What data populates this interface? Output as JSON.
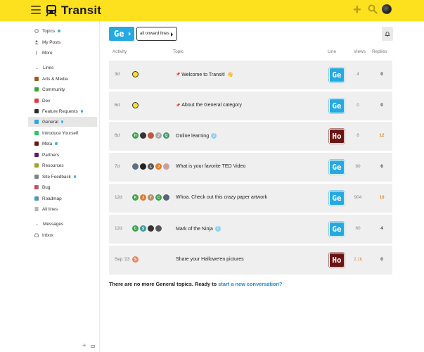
{
  "header": {
    "brand": "Transit",
    "menu_icon": "hamburger-icon",
    "logo_icon": "tram-icon",
    "actions": [
      "plus-icon",
      "search-icon",
      "avatar"
    ]
  },
  "sidebar": {
    "top": [
      {
        "label": "Topics",
        "icon": "topics-icon",
        "dot": true
      },
      {
        "label": "My Posts",
        "icon": "user-icon",
        "dot": false
      },
      {
        "label": "More",
        "icon": "more-icon",
        "dot": false
      }
    ],
    "lines_header": "Lines",
    "lines": [
      {
        "label": "Arts & Media",
        "color": "#a15a17",
        "dot": false
      },
      {
        "label": "Community",
        "color": "#3aa533",
        "dot": false
      },
      {
        "label": "Dev",
        "color": "#e5383b",
        "dot": false
      },
      {
        "label": "Feature Requests",
        "color": "#2b2b2b",
        "dot": true
      },
      {
        "label": "General",
        "color": "#25a9e0",
        "dot": true,
        "active": true
      },
      {
        "label": "Introduce Yourself",
        "color": "#2ac95b",
        "dot": false
      },
      {
        "label": "Meta",
        "color": "#6b1413",
        "dot": true
      },
      {
        "label": "Partners",
        "color": "#5b1d7a",
        "dot": false
      },
      {
        "label": "Resources",
        "color": "#a2a12c",
        "dot": false
      },
      {
        "label": "Site Feedback",
        "color": "#808285",
        "dot": true
      },
      {
        "label": "Bug",
        "color": "split-red",
        "dot": false
      },
      {
        "label": "Roadmap",
        "color": "split-blue",
        "dot": false
      },
      {
        "label": "All lines",
        "color": "list-icon",
        "dot": false
      }
    ],
    "messages_header": "Messages",
    "messages": [
      {
        "label": "Inbox",
        "icon": "inbox-icon"
      }
    ]
  },
  "toolbar": {
    "crumb_line": "Ge",
    "crumb_onward": "all onward lines"
  },
  "columns": {
    "activity": "Activity",
    "topic": "Topic",
    "line": "Line",
    "views": "Views",
    "replies": "Replies"
  },
  "topics": [
    {
      "activity": "3d",
      "title": "Welcome to Transit!",
      "pinned": true,
      "emoji": "👋",
      "line": "Ge",
      "line_kind": "ge",
      "views": "4",
      "replies": "0",
      "posters": [
        "#fde11e"
      ],
      "poster_letters": [
        ""
      ],
      "badge": ""
    },
    {
      "activity": "6d",
      "title": "About the General category",
      "pinned": true,
      "emoji": "",
      "line": "Ge",
      "line_kind": "ge",
      "views": "0",
      "replies": "0",
      "posters": [
        "#fde11e"
      ],
      "poster_letters": [
        ""
      ],
      "badge": ""
    },
    {
      "activity": "6d",
      "title": "Online learning",
      "pinned": false,
      "emoji": "",
      "line": "Ho",
      "line_kind": "ho",
      "views": "8",
      "replies": "12",
      "replies_hot": true,
      "posters": [
        "#3aa54a",
        "#333333",
        "#c1573d",
        "#a9a9a9",
        "#3f9a6b"
      ],
      "poster_letters": [
        "H",
        "",
        "",
        "J",
        "Q"
      ],
      "badge": "2"
    },
    {
      "activity": "7d",
      "title": "What is your favorite TED Video",
      "pinned": false,
      "emoji": "",
      "line": "Ge",
      "line_kind": "ge",
      "views": "80",
      "replies": "6",
      "posters": [
        "#5c7080",
        "#222222",
        "#555555",
        "#e07a2c",
        "#c8a0a0"
      ],
      "poster_letters": [
        "",
        "",
        "L",
        "J",
        ""
      ],
      "badge": ""
    },
    {
      "activity": "12d",
      "title": "Whoa. Check out this crazy paper artwork",
      "pinned": false,
      "emoji": "",
      "line": "Ge",
      "line_kind": "ge",
      "views": "904",
      "replies": "10",
      "replies_hot": true,
      "posters": [
        "#3aa54a",
        "#e07a2c",
        "#b68d6e",
        "#3aa54a",
        "#556677"
      ],
      "poster_letters": [
        "K",
        "J",
        "T",
        "C",
        ""
      ],
      "badge": ""
    },
    {
      "activity": "12d",
      "title": "Mark of the Ninja",
      "pinned": false,
      "emoji": "",
      "line": "Ge",
      "line_kind": "ge",
      "views": "60",
      "replies": "4",
      "posters": [
        "#3aa54a",
        "#3f9a9a",
        "#333333",
        "#555555"
      ],
      "poster_letters": [
        "C",
        "S",
        "",
        ""
      ],
      "badge": "1"
    },
    {
      "activity": "Sep '23",
      "title": "Share your Hallowe'en pictures",
      "pinned": false,
      "emoji": "",
      "line": "Ho",
      "line_kind": "ho",
      "views": "2.1k",
      "views_hot": true,
      "replies": "0",
      "posters": [
        "#e48a5c"
      ],
      "poster_letters": [
        "S"
      ],
      "badge": ""
    }
  ],
  "footer": {
    "text": "There are no more General topics. Ready to ",
    "link": "start a new conversation?"
  }
}
